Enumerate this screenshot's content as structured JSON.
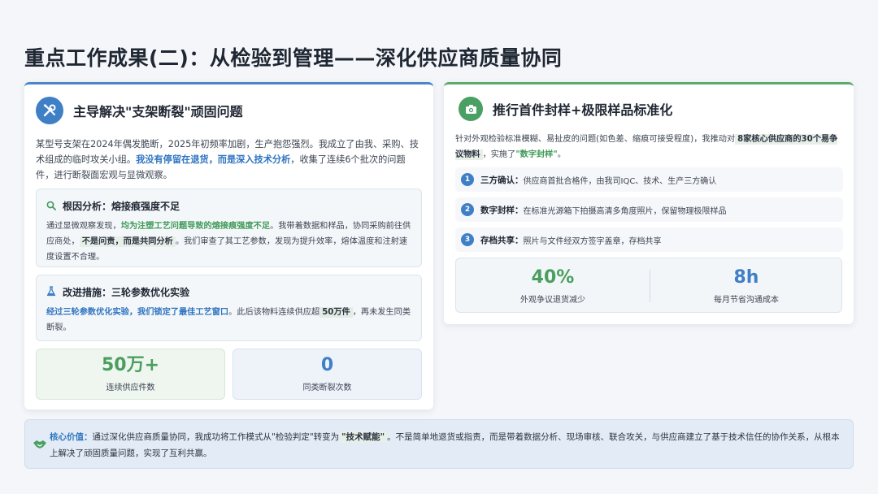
{
  "page_title": "重点工作成果(二)：从检验到管理——深化供应商质量协同",
  "left": {
    "title": "主导解决\"支架断裂\"顽固问题",
    "icon": "wrench-screwdriver-icon",
    "intro_1": "某型号支架在2024年偶发脆断，2025年初频率加剧，生产抱怨强烈。我成立了由我、采购、技术组成的临时攻关小组。",
    "intro_hl": "我没有停留在退货，而是深入技术分析",
    "intro_2": "，收集了连续6个批次的问题件，进行断裂面宏观与显微观察。",
    "root": {
      "icon": "search-icon",
      "title": "根因分析：熔接痕强度不足",
      "text_1": "通过显微观察发现，",
      "text_hl": "均为注塑工艺问题导致的熔接痕强度不足",
      "text_2": "。我带着数据和样品，协同采购前往供应商处，",
      "text_mark": "不是问责，而是共同分析",
      "text_3": "。我们审查了其工艺参数，发现为提升效率，熔体温度和注射速度设置不合理。"
    },
    "improve": {
      "icon": "flask-icon",
      "title": "改进措施：三轮参数优化实验",
      "text_hl": "经过三轮参数优化实验，我们锁定了最佳工艺窗口",
      "text_1": "。此后该物料连续供应超",
      "text_mark": "50万件",
      "text_2": "，再未发生同类断裂。"
    },
    "stats": [
      {
        "value": "50万+",
        "label": "连续供应件数"
      },
      {
        "value": "0",
        "label": "同类断裂次数"
      }
    ]
  },
  "right": {
    "title": "推行首件封样+极限样品标准化",
    "icon": "camera-icon",
    "intro_1": "针对外观检验标准模糊、易扯皮的问题(如色差、缩痕可接受程度)，我推动对",
    "intro_mark": "8家核心供应商的30个易争议物料",
    "intro_2": "，实施了",
    "intro_hl": "\"数字封样\"",
    "intro_3": "。",
    "steps": [
      {
        "num": "1",
        "label": "三方确认：",
        "text": "供应商首批合格件，由我司IQC、技术、生产三方确认"
      },
      {
        "num": "2",
        "label": "数字封样：",
        "text": "在标准光源箱下拍摄高清多角度照片，保留物理极限样品"
      },
      {
        "num": "3",
        "label": "存档共享：",
        "text": "照片与文件经双方签字盖章，存档共享"
      }
    ],
    "stats": [
      {
        "value": "40%",
        "label": "外观争议退货减少"
      },
      {
        "value": "8h",
        "label": "每月节省沟通成本"
      }
    ]
  },
  "bottom": {
    "icon": "handshake-icon",
    "label": "核心价值：",
    "text_1": "通过深化供应商质量协同，我成功将工作模式从\"检验判定\"转变为",
    "text_mark": "\"技术赋能\"",
    "text_2": "。不是简单地退货或指责，而是带着数据分析、现场审核、联合攻关，与供应商建立了基于技术信任的协作关系，从根本上解决了顽固质量问题，实现了互利共赢。"
  },
  "colors": {
    "accent_blue": "#3f7fc6",
    "accent_green": "#4a9e5e",
    "title_dark": "#1f2733"
  }
}
